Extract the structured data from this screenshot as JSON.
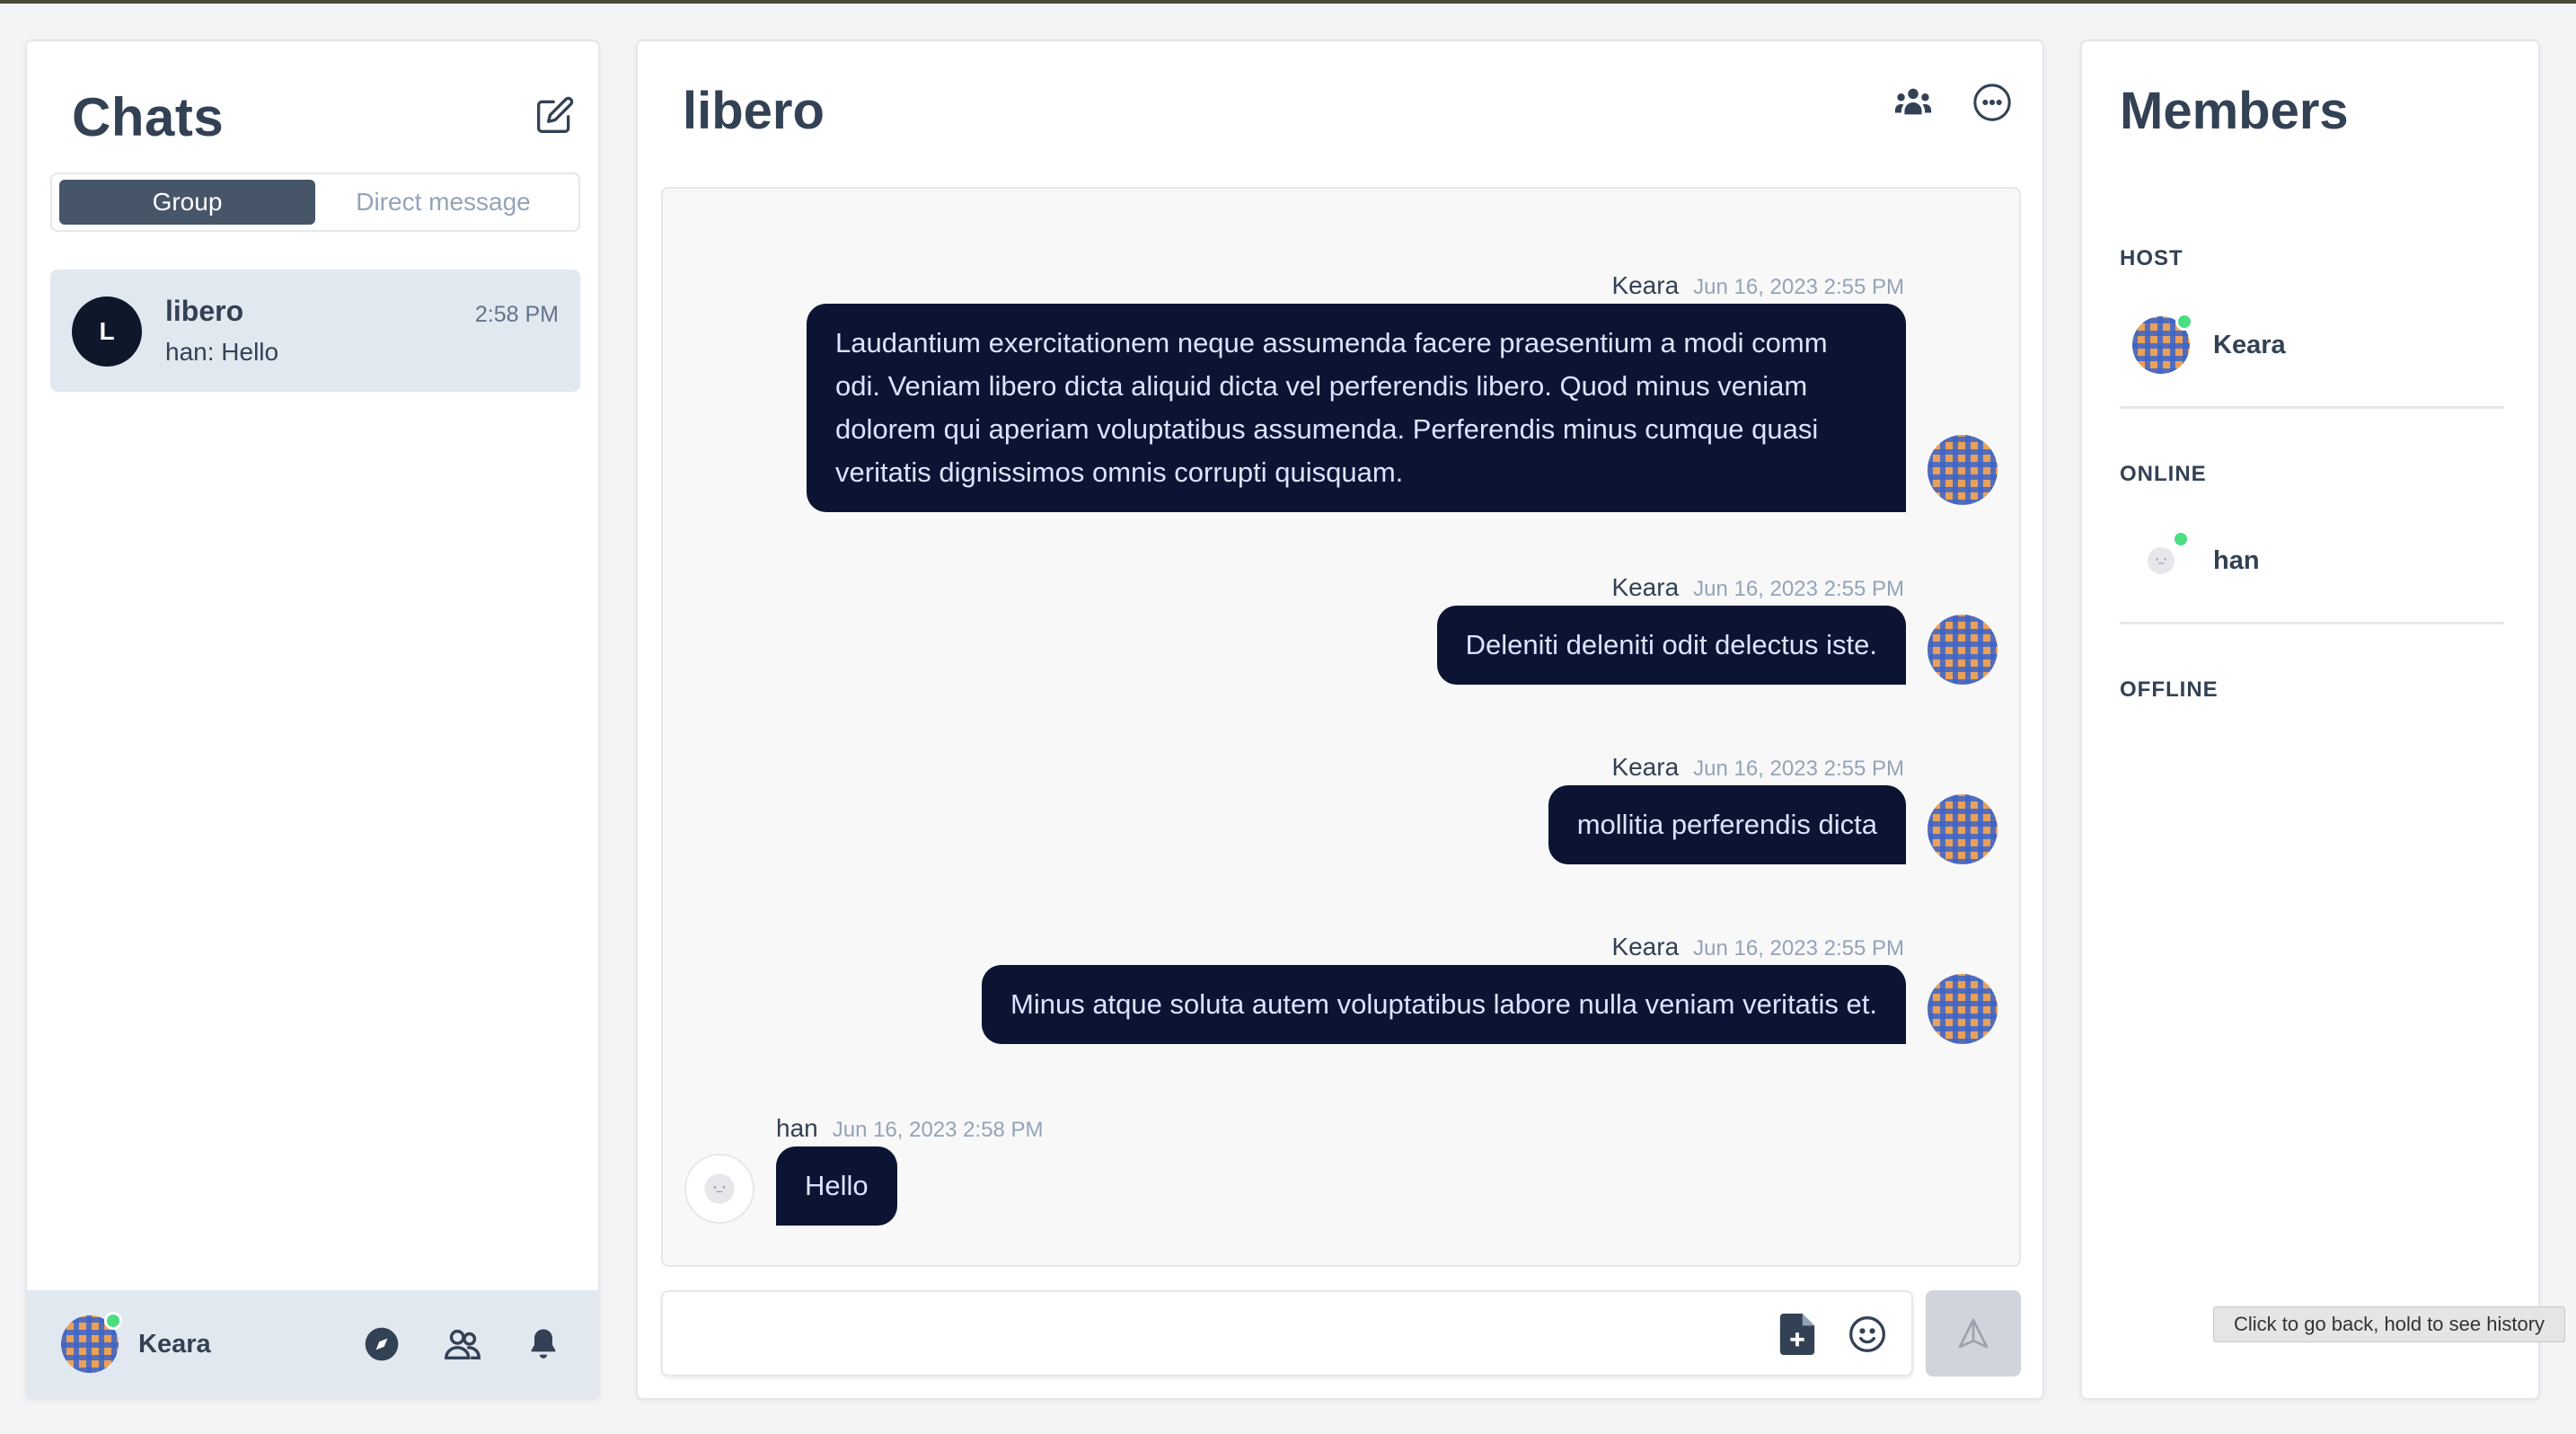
{
  "sidebar": {
    "title": "Chats",
    "tabs": [
      {
        "label": "Group",
        "active": true
      },
      {
        "label": "Direct message",
        "active": false
      }
    ],
    "chats": [
      {
        "avatar_letter": "L",
        "name": "libero",
        "preview": "han: Hello",
        "time": "2:58 PM"
      }
    ],
    "footer": {
      "user_name": "Keara"
    }
  },
  "room": {
    "title": "libero",
    "messages": [
      {
        "author": "Keara",
        "time": "Jun 16, 2023 2:55 PM",
        "text": "Laudantium exercitationem neque assumenda facere praesentium a modi comm odi. Veniam libero dicta aliquid dicta vel perferendis libero. Quod minus veniam dolorem qui aperiam voluptatibus assumenda. Perferendis minus cumque quasi veritatis dignissimos omnis corrupti quisquam.",
        "direction": "out"
      },
      {
        "author": "Keara",
        "time": "Jun 16, 2023 2:55 PM",
        "text": "Deleniti deleniti odit delectus iste.",
        "direction": "out"
      },
      {
        "author": "Keara",
        "time": "Jun 16, 2023 2:55 PM",
        "text": "mollitia perferendis dicta",
        "direction": "out"
      },
      {
        "author": "Keara",
        "time": "Jun 16, 2023 2:55 PM",
        "text": "Minus atque soluta autem voluptatibus labore nulla veniam veritatis et.",
        "direction": "out"
      },
      {
        "author": "han",
        "time": "Jun 16, 2023 2:58 PM",
        "text": "Hello",
        "direction": "in"
      }
    ],
    "composer": {
      "value": "",
      "placeholder": ""
    }
  },
  "members": {
    "title": "Members",
    "sections": [
      {
        "label": "HOST",
        "members": [
          "Keara"
        ]
      },
      {
        "label": "ONLINE",
        "members": [
          "han"
        ]
      },
      {
        "label": "OFFLINE",
        "members": []
      }
    ]
  },
  "tooltip": "Click to go back, hold to see history",
  "colors": {
    "bubble": "#0b1533",
    "bubble_text": "#dbe4ff",
    "active_tab": "#475569",
    "online": "#4ade80"
  }
}
